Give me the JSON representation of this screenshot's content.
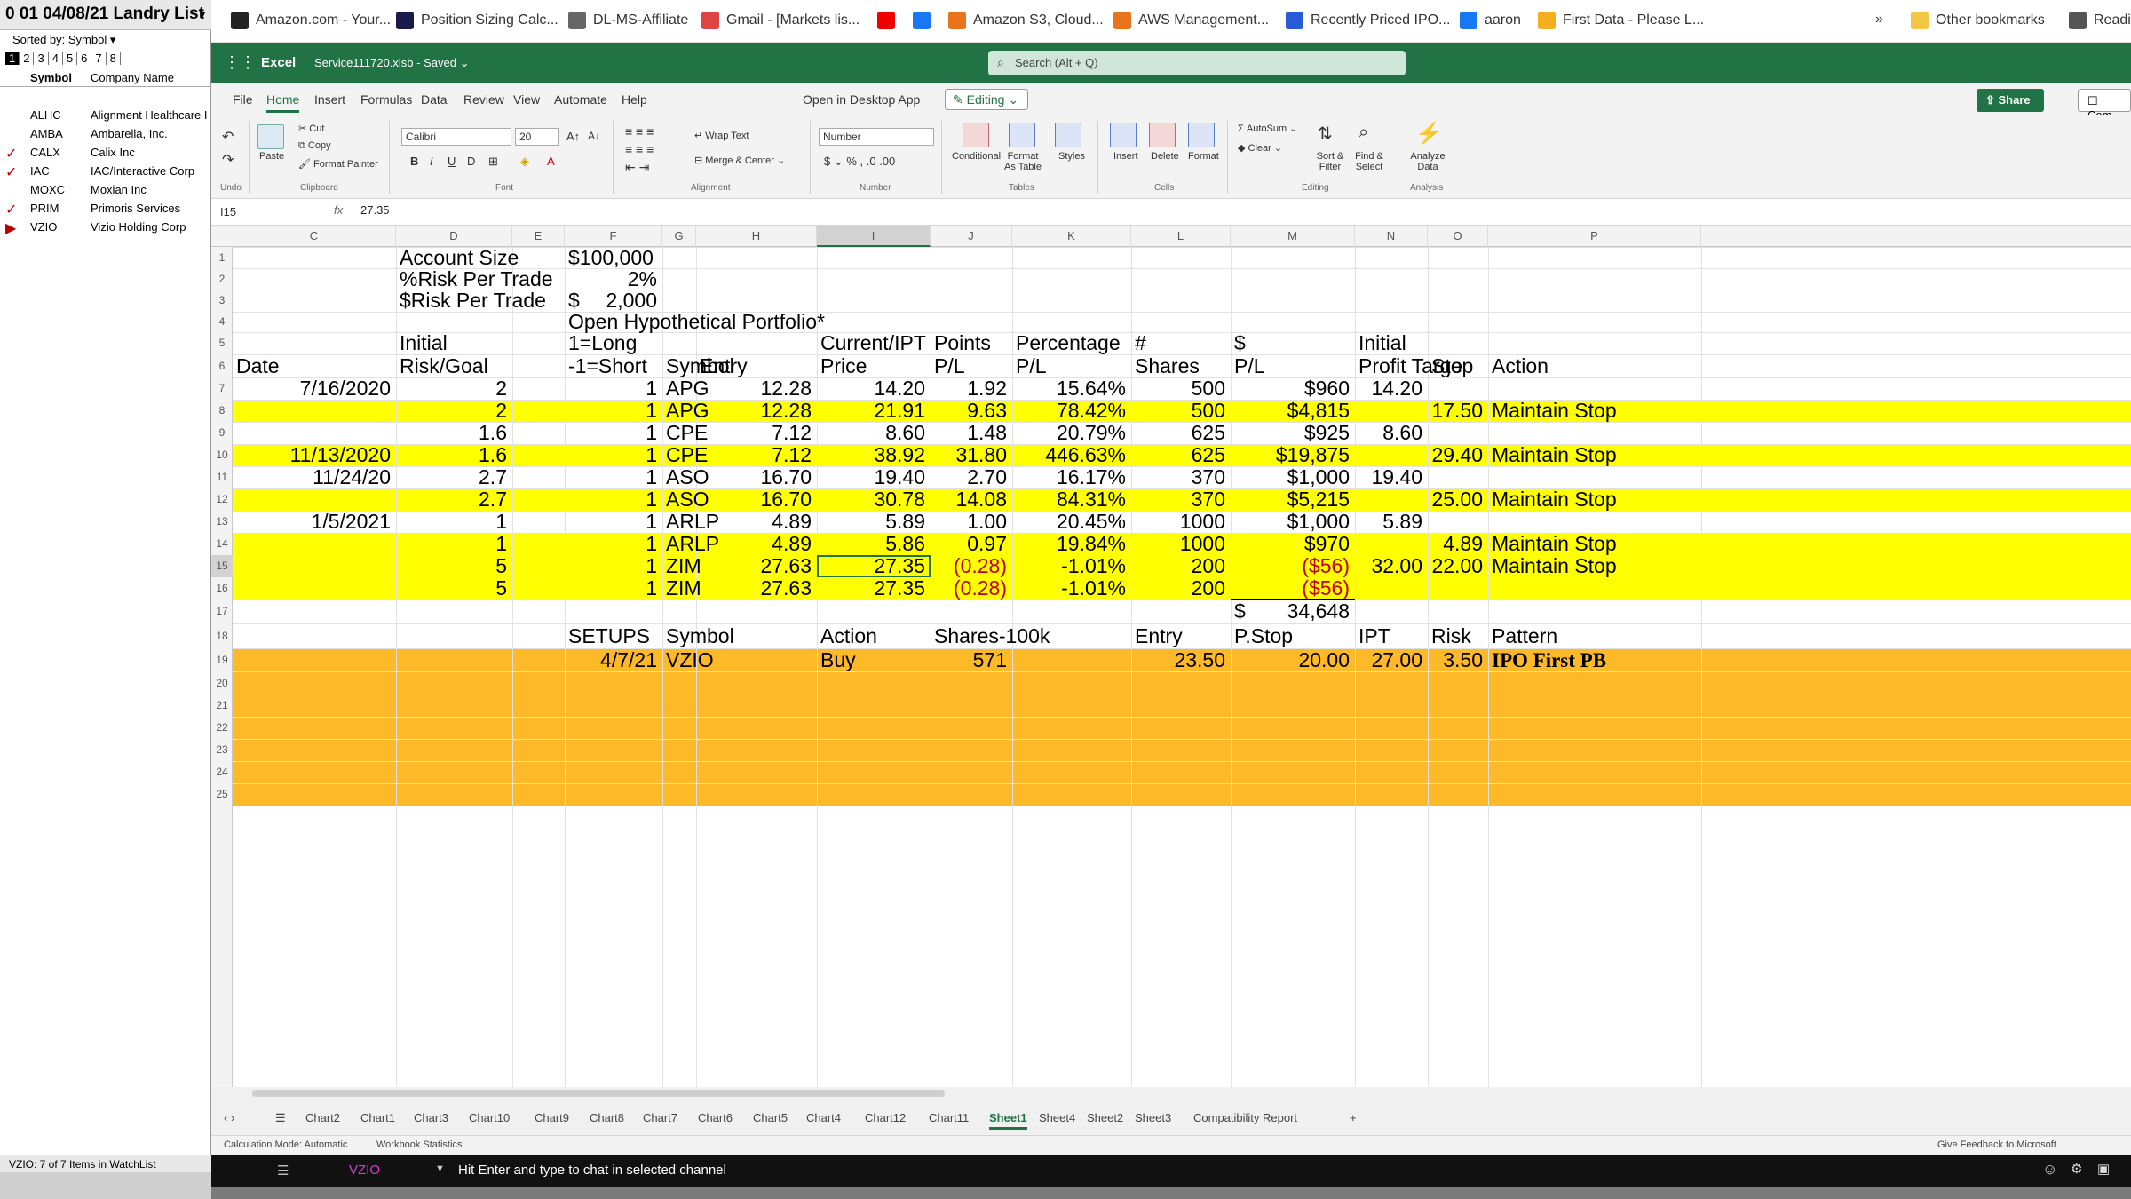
{
  "watchlist": {
    "title": "0 01 04/08/21 Landry List",
    "sorted_by": "Sorted by: Symbol",
    "page_tabs": [
      "1",
      "2",
      "3",
      "4",
      "5",
      "6",
      "7",
      "8"
    ],
    "col_symbol": "Symbol",
    "col_company": "Company Name",
    "rows": [
      {
        "symbol": "ALHC",
        "company": "Alignment Healthcare I",
        "mark": ""
      },
      {
        "symbol": "AMBA",
        "company": "Ambarella, Inc.",
        "mark": ""
      },
      {
        "symbol": "CALX",
        "company": "Calix Inc",
        "mark": "✓"
      },
      {
        "symbol": "IAC",
        "company": "IAC/Interactive Corp",
        "mark": "✓"
      },
      {
        "symbol": "MOXC",
        "company": "Moxian Inc",
        "mark": ""
      },
      {
        "symbol": "PRIM",
        "company": "Primoris Services",
        "mark": "✓"
      },
      {
        "symbol": "VZIO",
        "company": "Vizio Holding Corp",
        "mark": "▶"
      }
    ],
    "footer": "VZIO: 7 of 7 Items in WatchList"
  },
  "bookmarks": [
    {
      "label": "Amazon.com - Your...",
      "color": "#222"
    },
    {
      "label": "Position Sizing Calc...",
      "color": "#1a1a4a"
    },
    {
      "label": "DL-MS-Affiliate",
      "color": "#666"
    },
    {
      "label": "Gmail - [Markets lis...",
      "color": "#d44"
    },
    {
      "label": "",
      "color": "#e00"
    },
    {
      "label": "",
      "color": "#1877f2"
    },
    {
      "label": "Amazon S3, Cloud...",
      "color": "#e8741c"
    },
    {
      "label": "AWS Management...",
      "color": "#e8741c"
    },
    {
      "label": "Recently Priced IPO...",
      "color": "#2a5bd7"
    },
    {
      "label": "aaron",
      "color": "#1877f2"
    },
    {
      "label": "First Data - Please L...",
      "color": "#f2b01e"
    },
    {
      "label": "»",
      "color": ""
    },
    {
      "label": "Other bookmarks",
      "color": "#f2c744"
    },
    {
      "label": "Readi",
      "color": "#555"
    }
  ],
  "excel": {
    "app_name": "Excel",
    "file_name": "Service111720.xlsb  -  Saved",
    "search_placeholder": "Search (Alt + Q)",
    "tabs": [
      "File",
      "Home",
      "Insert",
      "Formulas",
      "Data",
      "Review",
      "View",
      "Automate",
      "Help",
      "Open in Desktop App"
    ],
    "editing": "Editing",
    "share": "Share",
    "comments": "Com",
    "ribbon": {
      "undo": "Undo",
      "paste": "Paste",
      "cut": "Cut",
      "copy": "Copy",
      "format_painter": "Format Painter",
      "clipboard": "Clipboard",
      "font_name": "Calibri",
      "font_size": "20",
      "font": "Font",
      "wrap_text": "Wrap Text",
      "merge_center": "Merge & Center",
      "alignment": "Alignment",
      "number_format": "Number",
      "number": "Number",
      "conditional": "Conditional",
      "format_as_table": "Format As Table",
      "styles": "Styles",
      "tables": "Tables",
      "insert": "Insert",
      "delete": "Delete",
      "format": "Format",
      "cells": "Cells",
      "autosum": "AutoSum",
      "clear": "Clear",
      "sort_filter": "Sort & Filter",
      "find_select": "Find & Select",
      "editing": "Editing",
      "analyze_data": "Analyze Data",
      "analysis": "Analysis"
    },
    "name_box": "I15",
    "formula_value": "27.35",
    "columns": [
      "C",
      "D",
      "E",
      "F",
      "G",
      "H",
      "I",
      "J",
      "K",
      "L",
      "M",
      "N",
      "O",
      "P"
    ],
    "rows": [
      "1",
      "2",
      "3",
      "4",
      "5",
      "6",
      "7",
      "8",
      "9",
      "10",
      "11",
      "12",
      "13",
      "14",
      "15",
      "16",
      "17",
      "18",
      "19",
      "20",
      "21",
      "22",
      "23",
      "24",
      "25"
    ],
    "sheet_tabs": [
      "Chart2",
      "Chart1",
      "Chart3",
      "Chart10",
      "Chart9",
      "Chart8",
      "Chart7",
      "Chart6",
      "Chart5",
      "Chart4",
      "Chart12",
      "Chart11",
      "Sheet1",
      "Sheet4",
      "Sheet2",
      "Sheet3",
      "Compatibility Report",
      "+"
    ],
    "active_sheet": "Sheet1",
    "status_left": "Calculation Mode: Automatic",
    "status_mid": "Workbook Statistics",
    "status_right": "Give Feedback to Microsoft"
  },
  "sheet": {
    "account_size_label": "Account Size",
    "account_size": "$100,000",
    "risk_pct_label": "%Risk Per Trade",
    "risk_pct": "2%",
    "risk_dollar_label": "$Risk Per Trade",
    "risk_dollar_sign": "$",
    "risk_dollar": "2,000",
    "portfolio_title": "Open Hypothetical Portfolio*",
    "header5": {
      "D": "Initial",
      "F": "1=Long",
      "I": "Current/IPT",
      "J": "Points",
      "K": "Percentage",
      "L": "#",
      "M": "$",
      "N": "Initial"
    },
    "header6": {
      "C": "Date",
      "D": "Risk/Goal",
      "F": "-1=Short",
      "G": "Symbol",
      "H": "Entry",
      "I": "Price",
      "J": "P/L",
      "K": "P/L",
      "L": "Shares",
      "M": "P/L",
      "N": "Profit Targe",
      "O": "Stop",
      "P": "Action"
    },
    "trades": [
      {
        "date": "7/16/2020",
        "risk": "2",
        "dir": "1",
        "symbol": "APG",
        "entry": "12.28",
        "price": "14.20",
        "points": "1.92",
        "pct": "15.64%",
        "shares": "500",
        "pl": "$960",
        "target": "14.20",
        "stop": "",
        "action": "",
        "hl": false,
        "neg": false
      },
      {
        "date": "",
        "risk": "2",
        "dir": "1",
        "symbol": "APG",
        "entry": "12.28",
        "price": "21.91",
        "points": "9.63",
        "pct": "78.42%",
        "shares": "500",
        "pl": "$4,815",
        "target": "",
        "stop": "17.50",
        "action": "Maintain Stop",
        "hl": true,
        "neg": false
      },
      {
        "date": "",
        "risk": "1.6",
        "dir": "1",
        "symbol": "CPE",
        "entry": "7.12",
        "price": "8.60",
        "points": "1.48",
        "pct": "20.79%",
        "shares": "625",
        "pl": "$925",
        "target": "8.60",
        "stop": "",
        "action": "",
        "hl": false,
        "neg": false
      },
      {
        "date": "11/13/2020",
        "risk": "1.6",
        "dir": "1",
        "symbol": "CPE",
        "entry": "7.12",
        "price": "38.92",
        "points": "31.80",
        "pct": "446.63%",
        "shares": "625",
        "pl": "$19,875",
        "target": "",
        "stop": "29.40",
        "action": "Maintain Stop",
        "hl": true,
        "neg": false
      },
      {
        "date": "11/24/20",
        "risk": "2.7",
        "dir": "1",
        "symbol": "ASO",
        "entry": "16.70",
        "price": "19.40",
        "points": "2.70",
        "pct": "16.17%",
        "shares": "370",
        "pl": "$1,000",
        "target": "19.40",
        "stop": "",
        "action": "",
        "hl": false,
        "neg": false
      },
      {
        "date": "",
        "risk": "2.7",
        "dir": "1",
        "symbol": "ASO",
        "entry": "16.70",
        "price": "30.78",
        "points": "14.08",
        "pct": "84.31%",
        "shares": "370",
        "pl": "$5,215",
        "target": "",
        "stop": "25.00",
        "action": "Maintain Stop",
        "hl": true,
        "neg": false
      },
      {
        "date": "1/5/2021",
        "risk": "1",
        "dir": "1",
        "symbol": "ARLP",
        "entry": "4.89",
        "price": "5.89",
        "points": "1.00",
        "pct": "20.45%",
        "shares": "1000",
        "pl": "$1,000",
        "target": "5.89",
        "stop": "",
        "action": "",
        "hl": false,
        "neg": false
      },
      {
        "date": "",
        "risk": "1",
        "dir": "1",
        "symbol": "ARLP",
        "entry": "4.89",
        "price": "5.86",
        "points": "0.97",
        "pct": "19.84%",
        "shares": "1000",
        "pl": "$970",
        "target": "",
        "stop": "4.89",
        "action": "Maintain Stop",
        "hl": true,
        "neg": false
      },
      {
        "date": "",
        "risk": "5",
        "dir": "1",
        "symbol": "ZIM",
        "entry": "27.63",
        "price": "27.35",
        "points": "(0.28)",
        "pct": "-1.01%",
        "shares": "200",
        "pl": "($56)",
        "target": "32.00",
        "stop": "22.00",
        "action": "Maintain Stop",
        "hl": true,
        "neg": true
      },
      {
        "date": "",
        "risk": "5",
        "dir": "1",
        "symbol": "ZIM",
        "entry": "27.63",
        "price": "27.35",
        "points": "(0.28)",
        "pct": "-1.01%",
        "shares": "200",
        "pl": "($56)",
        "target": "",
        "stop": "",
        "action": "",
        "hl": true,
        "neg": true
      }
    ],
    "total_sign": "$",
    "total": "34,648",
    "setups_header": {
      "F": "SETUPS",
      "G": "Symbol",
      "I": "Action",
      "J": "Shares-100k",
      "L": "Entry",
      "M": "P.Stop",
      "N": "IPT",
      "O": "Risk",
      "P": "Pattern"
    },
    "setup": {
      "date": "4/7/21",
      "symbol": "VZIO",
      "action": "Buy",
      "shares": "571",
      "entry": "23.50",
      "pstop": "20.00",
      "ipt": "27.00",
      "risk": "3.50",
      "pattern": "IPO First PB"
    }
  },
  "chat": {
    "channel": "VZIO",
    "message": "Hit Enter and type to chat in selected channel"
  },
  "colors": {
    "excel_green": "#217346",
    "highlight_yellow": "#ffff00",
    "setup_orange": "#fdb927",
    "negative_red": "#c00000"
  }
}
